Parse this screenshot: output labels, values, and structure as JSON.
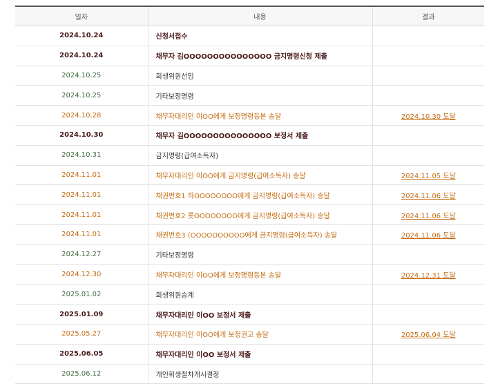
{
  "table": {
    "headers": {
      "date": "일자",
      "content": "내용",
      "result": "결과"
    },
    "rows": [
      {
        "date": "2024.10.24",
        "content": "신청서접수",
        "result": "",
        "type": "submit"
      },
      {
        "date": "2024.10.24",
        "content": "채무자 김OOOOOOOOOOOOOOO 금지명령신청 제출",
        "result": "",
        "type": "submit"
      },
      {
        "date": "2024.10.25",
        "content": "회생위원선임",
        "result": "",
        "type": "court"
      },
      {
        "date": "2024.10.25",
        "content": "기타보정명령",
        "result": "",
        "type": "court"
      },
      {
        "date": "2024.10.28",
        "content": "채무자대리인 이OO에게 보정명령등본 송달",
        "result": "2024.10.30 도달",
        "type": "delivery"
      },
      {
        "date": "2024.10.30",
        "content": "채무자 김OOOOOOOOOOOOOOO 보정서 제출",
        "result": "",
        "type": "submit"
      },
      {
        "date": "2024.10.31",
        "content": "금지명령(급여소득자)",
        "result": "",
        "type": "court"
      },
      {
        "date": "2024.11.01",
        "content": "채무자대리인 이OO에게 금지명령(급여소득자) 송달",
        "result": "2024.11.05 도달",
        "type": "delivery"
      },
      {
        "date": "2024.11.01",
        "content": "채권번호1 하OOOOOOOO에게 금지명령(급여소득자) 송달",
        "result": "2024.11.06 도달",
        "type": "delivery"
      },
      {
        "date": "2024.11.01",
        "content": "채권번호2 롯OOOOOOOO에게 금지명령(급여소득자) 송달",
        "result": "2024.11.06 도달",
        "type": "delivery"
      },
      {
        "date": "2024.11.01",
        "content": "채권번호3 (OOOOOOOOOO에게 금지명령(급여소득자) 송달",
        "result": "2024.11.06 도달",
        "type": "delivery"
      },
      {
        "date": "2024.12.27",
        "content": "기타보정명령",
        "result": "",
        "type": "court"
      },
      {
        "date": "2024.12.30",
        "content": "채무자대리인 이OO에게 보정명령등본 송달",
        "result": "2024.12.31 도달",
        "type": "delivery"
      },
      {
        "date": "2025.01.02",
        "content": "회생위원승계",
        "result": "",
        "type": "court"
      },
      {
        "date": "2025.01.09",
        "content": "채무자대리인 이OO 보정서 제출",
        "result": "",
        "type": "submit"
      },
      {
        "date": "2025.05.27",
        "content": "채무자대리인 이OO에게 보정권고 송달",
        "result": "2025.06.04 도달",
        "type": "delivery"
      },
      {
        "date": "2025.06.05",
        "content": "채무자대리인 이OO 보정서 제출",
        "result": "",
        "type": "submit"
      },
      {
        "date": "2025.06.12",
        "content": "개인회생절차개시결정",
        "result": "",
        "type": "court"
      }
    ]
  },
  "colors": {
    "submit": "#4a1a1a",
    "court_date": "#3f6b3f",
    "delivery": "#c46a0e",
    "header_border": "#555555"
  }
}
